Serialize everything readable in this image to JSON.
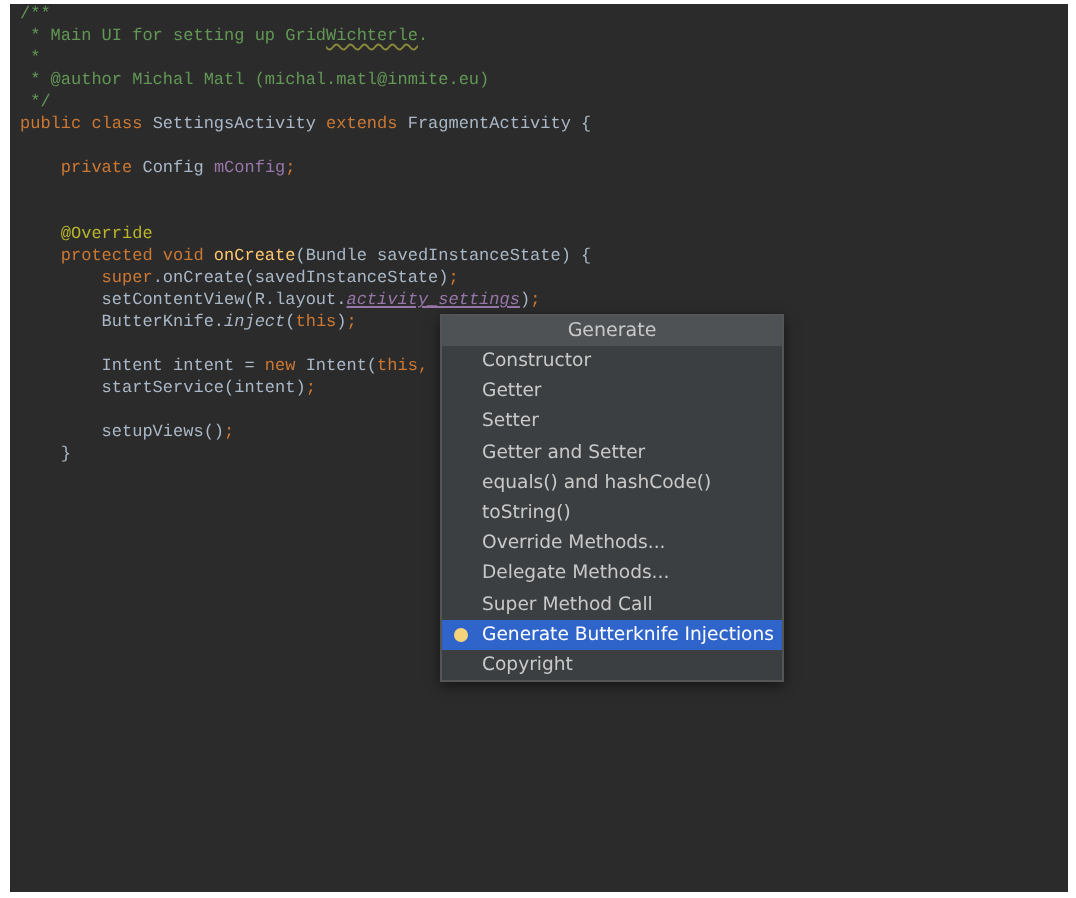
{
  "editor": {
    "lines": [
      {
        "kind": "code",
        "tokens": [
          {
            "text": "/**",
            "kind": "comment"
          }
        ]
      },
      {
        "kind": "code",
        "tokens": [
          {
            "text": " * Main UI for setting up Grid",
            "kind": "comment"
          },
          {
            "text": "Wichterle",
            "kind": "comment-typo"
          },
          {
            "text": ".",
            "kind": "comment"
          }
        ]
      },
      {
        "kind": "code",
        "tokens": [
          {
            "text": " *",
            "kind": "comment"
          }
        ]
      },
      {
        "kind": "code",
        "tokens": [
          {
            "text": " * @author Michal Matl (michal.matl@inmite.eu)",
            "kind": "comment"
          }
        ]
      },
      {
        "kind": "code",
        "tokens": [
          {
            "text": " */",
            "kind": "comment"
          }
        ]
      },
      {
        "kind": "code",
        "tokens": [
          {
            "text": "public class ",
            "kind": "keyword"
          },
          {
            "text": "SettingsActivity ",
            "kind": "plain"
          },
          {
            "text": "extends ",
            "kind": "keyword"
          },
          {
            "text": "FragmentActivity {",
            "kind": "plain"
          }
        ]
      },
      {
        "kind": "blank"
      },
      {
        "kind": "code",
        "tokens": [
          {
            "text": "    private ",
            "kind": "keyword"
          },
          {
            "text": "Config ",
            "kind": "plain"
          },
          {
            "text": "mConfig",
            "kind": "field"
          },
          {
            "text": ";",
            "kind": "keyword"
          }
        ]
      },
      {
        "kind": "blank"
      },
      {
        "kind": "blank"
      },
      {
        "kind": "code",
        "tokens": [
          {
            "text": "    @Override",
            "kind": "annotation"
          }
        ]
      },
      {
        "kind": "code",
        "tokens": [
          {
            "text": "    protected void ",
            "kind": "keyword"
          },
          {
            "text": "onCreate",
            "kind": "method"
          },
          {
            "text": "(Bundle savedInstanceState) {",
            "kind": "plain"
          }
        ]
      },
      {
        "kind": "code",
        "tokens": [
          {
            "text": "        super",
            "kind": "keyword"
          },
          {
            "text": ".onCreate(savedInstanceState)",
            "kind": "plain"
          },
          {
            "text": ";",
            "kind": "keyword"
          }
        ]
      },
      {
        "kind": "code",
        "tokens": [
          {
            "text": "        setContentView(R.layout.",
            "kind": "plain"
          },
          {
            "text": "activity_settings",
            "kind": "resource"
          },
          {
            "text": ")",
            "kind": "plain"
          },
          {
            "text": ";",
            "kind": "keyword"
          }
        ]
      },
      {
        "kind": "code",
        "tokens": [
          {
            "text": "        ButterKnife.",
            "kind": "plain"
          },
          {
            "text": "inject",
            "kind": "static"
          },
          {
            "text": "(",
            "kind": "plain"
          },
          {
            "text": "this",
            "kind": "keyword"
          },
          {
            "text": ")",
            "kind": "plain"
          },
          {
            "text": ";",
            "kind": "keyword"
          }
        ]
      },
      {
        "kind": "blank"
      },
      {
        "kind": "code",
        "tokens": [
          {
            "text": "        Intent intent = ",
            "kind": "plain"
          },
          {
            "text": "new ",
            "kind": "keyword"
          },
          {
            "text": "Intent(",
            "kind": "plain"
          },
          {
            "text": "this,",
            "kind": "keyword"
          }
        ]
      },
      {
        "kind": "code",
        "tokens": [
          {
            "text": "        startService(intent)",
            "kind": "plain"
          },
          {
            "text": ";",
            "kind": "keyword"
          }
        ]
      },
      {
        "kind": "blank"
      },
      {
        "kind": "code",
        "tokens": [
          {
            "text": "        setupViews()",
            "kind": "plain"
          },
          {
            "text": ";",
            "kind": "keyword"
          }
        ]
      },
      {
        "kind": "code",
        "tokens": [
          {
            "text": "    }",
            "kind": "plain"
          }
        ]
      }
    ]
  },
  "popup": {
    "title": "Generate",
    "items": [
      {
        "label": "Constructor",
        "selected": false
      },
      {
        "label": "Getter",
        "selected": false
      },
      {
        "label": "Setter",
        "selected": false
      },
      {
        "label": "Getter and Setter",
        "selected": false
      },
      {
        "label": "equals() and hashCode()",
        "selected": false
      },
      {
        "label": "toString()",
        "selected": false
      },
      {
        "label": "Override Methods...",
        "selected": false
      },
      {
        "label": "Delegate Methods...",
        "selected": false
      },
      {
        "label": "Super Method Call",
        "selected": false
      },
      {
        "label": "Generate Butterknife Injections",
        "selected": true
      },
      {
        "label": "Copyright",
        "selected": false
      }
    ]
  }
}
